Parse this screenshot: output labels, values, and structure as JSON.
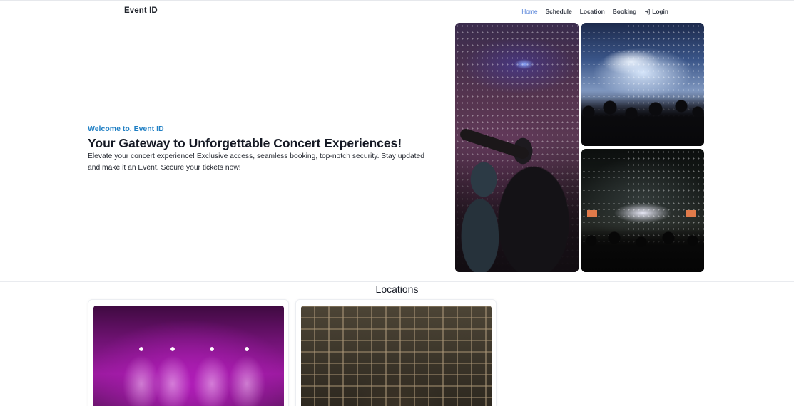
{
  "navbar": {
    "brand": "Event ID",
    "links": [
      {
        "label": "Home",
        "active": true
      },
      {
        "label": "Schedule",
        "active": false
      },
      {
        "label": "Location",
        "active": false
      },
      {
        "label": "Booking",
        "active": false
      }
    ],
    "login": {
      "label": "Login",
      "icon": "login-icon"
    }
  },
  "hero": {
    "welcome": "Welcome to, Event ID",
    "title": "Your Gateway to Unforgettable Concert Experiences!",
    "description": "Elevate your concert experience! Exclusive access, seamless booking, top-notch security. Stay updated and make it an Event. Secure your tickets now!"
  },
  "gallery": {
    "images": [
      "concert-crowd-photo",
      "stage-lights-photo",
      "confetti-stage-photo"
    ]
  },
  "locations": {
    "title": "Locations",
    "cards": [
      {
        "image": "purple-stage-photo"
      },
      {
        "image": "stage-truss-photo"
      }
    ]
  },
  "colors": {
    "accent": "#1f7fc4",
    "active_nav": "#4f7ed8",
    "text": "#151924"
  }
}
